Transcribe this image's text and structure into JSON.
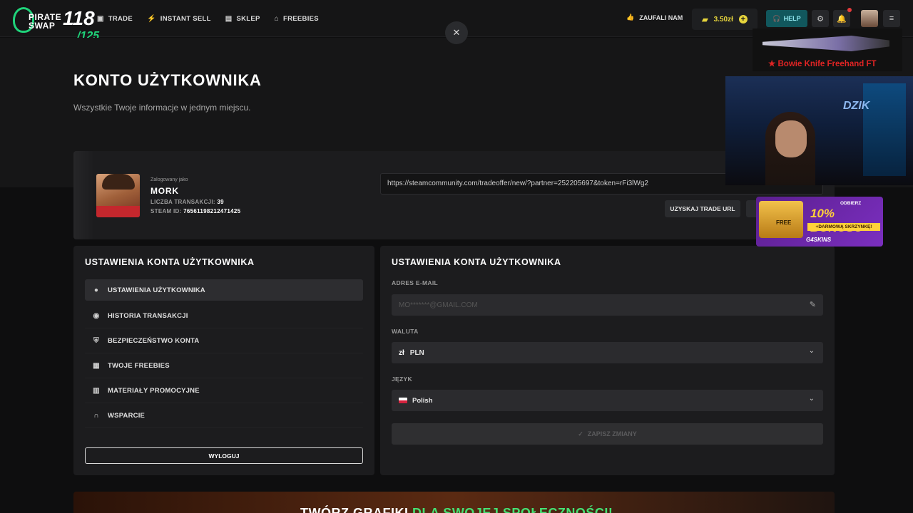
{
  "brand": {
    "name": "PIRATE SWAP",
    "counter": "118",
    "counter_total": "/125"
  },
  "nav": [
    {
      "label": "TRADE",
      "icon": "trade-icon"
    },
    {
      "label": "INSTANT SELL",
      "icon": "bolt-icon"
    },
    {
      "label": "SKLEP",
      "icon": "store-icon"
    },
    {
      "label": "FREEBIES",
      "icon": "gift-icon"
    }
  ],
  "topbar": {
    "trust_label": "ZAUFALI NAM",
    "balance": "3.50zł",
    "help_label": "HELP"
  },
  "hero": {
    "title": "KONTO UŻYTKOWNIKA",
    "subtitle": "Wszystkie Twoje informacje w jednym miejscu."
  },
  "profile": {
    "logged_as_label": "Zalogowany jako",
    "username": "MORK",
    "transactions_label": "LICZBA TRANSAKCJI:",
    "transactions": "39",
    "steam_id_label": "STEAM ID:",
    "steam_id": "76561198212471425",
    "trade_url": "https://steamcommunity.com/tradeoffer/new/?partner=252205697&token=rFi3lWg2",
    "get_trade_url_label": "UZYSKAJ TRADE URL"
  },
  "left_panel": {
    "title": "USTAWIENIA KONTA UŻYTKOWNIKA",
    "menu": [
      {
        "label": "USTAWIENIA UŻYTKOWNIKA",
        "icon": "user-icon"
      },
      {
        "label": "HISTORIA TRANSAKCJI",
        "icon": "history-icon"
      },
      {
        "label": "BEZPIECZEŃSTWO KONTA",
        "icon": "shield-icon"
      },
      {
        "label": "TWOJE FREEBIES",
        "icon": "gift-icon"
      },
      {
        "label": "MATERIAŁY PROMOCYJNE",
        "icon": "briefcase-icon"
      },
      {
        "label": "WSPARCIE",
        "icon": "headset-icon"
      }
    ],
    "logout_label": "WYLOGUJ"
  },
  "right_panel": {
    "title": "USTAWIENIA KONTA UŻYTKOWNIKA",
    "email_label": "ADRES E-MAIL",
    "email_value": "MO*******@GMAIL.COM",
    "currency_label": "WALUTA",
    "currency_symbol": "zł",
    "currency_value": "PLN",
    "language_label": "JĘZYK",
    "language_value": "Polish",
    "save_label": "ZAPISZ ZMIANY"
  },
  "overlays": {
    "knife_label": "★ Bowie Knife Freehand FT",
    "webcam_sign": "DZIK",
    "bonus_top": "ODBIERZ",
    "bonus_pct": "10% BONUSU",
    "bonus_sub": "+DARMOWĄ SKRZYNKĘ!",
    "bonus_brand": "G4SKINS",
    "bonus_chest": "FREE"
  },
  "banner": {
    "text_white": "TWÓRZ GRAFIKI ",
    "text_green": "DLA SWOJEJ SPOŁECZNOŚCI!"
  },
  "colors": {
    "accent_green": "#1fd37a",
    "balance_yellow": "#e7d53c",
    "help_teal": "#11575d"
  }
}
